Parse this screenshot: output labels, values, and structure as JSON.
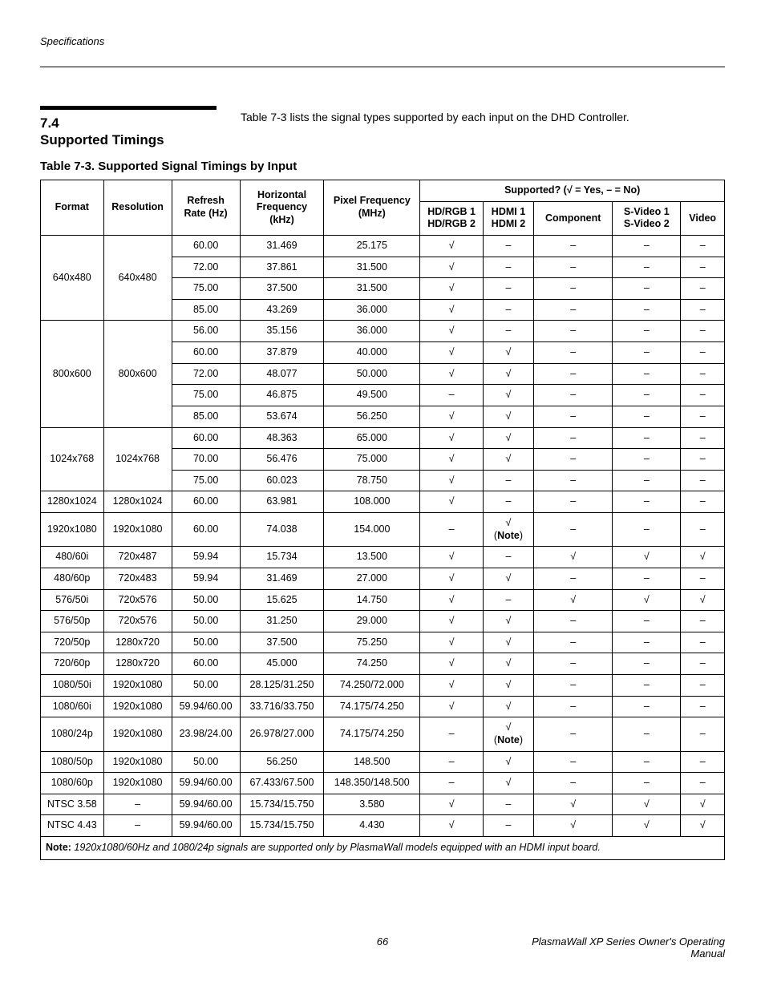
{
  "running_head": "Specifications",
  "section": {
    "number": "7.4",
    "title": "Supported Timings",
    "intro": "Table 7-3 lists the signal types supported by each input on the DHD Controller."
  },
  "table_caption": "Table 7-3. Supported Signal Timings by Input",
  "headers": {
    "format": "Format",
    "resolution": "Resolution",
    "refresh": "Refresh Rate (Hz)",
    "hfreq": "Horizontal Frequency (kHz)",
    "pfreq": "Pixel Frequency (MHz)",
    "supported": "Supported? (√ = Yes, – = No)",
    "hdrgb_l1": "HD/RGB 1",
    "hdrgb_l2": "HD/RGB 2",
    "hdmi_l1": "HDMI 1",
    "hdmi_l2": "HDMI 2",
    "component": "Component",
    "svideo_l1": "S-Video 1",
    "svideo_l2": "S-Video 2",
    "video": "Video"
  },
  "chart_data": {
    "type": "table",
    "title": "Table 7-3. Supported Signal Timings by Input",
    "columns": [
      "Format",
      "Resolution",
      "Refresh Rate (Hz)",
      "Horizontal Frequency (kHz)",
      "Pixel Frequency (MHz)",
      "HD/RGB 1 HD/RGB 2",
      "HDMI 1 HDMI 2",
      "Component",
      "S-Video 1 S-Video 2",
      "Video"
    ],
    "groups": [
      {
        "format": "640x480",
        "resolution": "640x480",
        "rows": [
          {
            "refresh": "60.00",
            "hfreq": "31.469",
            "pfreq": "25.175",
            "hdrgb": "y",
            "hdmi": "n",
            "comp": "n",
            "svid": "n",
            "vid": "n"
          },
          {
            "refresh": "72.00",
            "hfreq": "37.861",
            "pfreq": "31.500",
            "hdrgb": "y",
            "hdmi": "n",
            "comp": "n",
            "svid": "n",
            "vid": "n"
          },
          {
            "refresh": "75.00",
            "hfreq": "37.500",
            "pfreq": "31.500",
            "hdrgb": "y",
            "hdmi": "n",
            "comp": "n",
            "svid": "n",
            "vid": "n"
          },
          {
            "refresh": "85.00",
            "hfreq": "43.269",
            "pfreq": "36.000",
            "hdrgb": "y",
            "hdmi": "n",
            "comp": "n",
            "svid": "n",
            "vid": "n"
          }
        ]
      },
      {
        "format": "800x600",
        "resolution": "800x600",
        "rows": [
          {
            "refresh": "56.00",
            "hfreq": "35.156",
            "pfreq": "36.000",
            "hdrgb": "y",
            "hdmi": "n",
            "comp": "n",
            "svid": "n",
            "vid": "n"
          },
          {
            "refresh": "60.00",
            "hfreq": "37.879",
            "pfreq": "40.000",
            "hdrgb": "y",
            "hdmi": "y",
            "comp": "n",
            "svid": "n",
            "vid": "n"
          },
          {
            "refresh": "72.00",
            "hfreq": "48.077",
            "pfreq": "50.000",
            "hdrgb": "y",
            "hdmi": "y",
            "comp": "n",
            "svid": "n",
            "vid": "n"
          },
          {
            "refresh": "75.00",
            "hfreq": "46.875",
            "pfreq": "49.500",
            "hdrgb": "n",
            "hdmi": "y",
            "comp": "n",
            "svid": "n",
            "vid": "n"
          },
          {
            "refresh": "85.00",
            "hfreq": "53.674",
            "pfreq": "56.250",
            "hdrgb": "y",
            "hdmi": "y",
            "comp": "n",
            "svid": "n",
            "vid": "n"
          }
        ]
      },
      {
        "format": "1024x768",
        "resolution": "1024x768",
        "rows": [
          {
            "refresh": "60.00",
            "hfreq": "48.363",
            "pfreq": "65.000",
            "hdrgb": "y",
            "hdmi": "y",
            "comp": "n",
            "svid": "n",
            "vid": "n"
          },
          {
            "refresh": "70.00",
            "hfreq": "56.476",
            "pfreq": "75.000",
            "hdrgb": "y",
            "hdmi": "y",
            "comp": "n",
            "svid": "n",
            "vid": "n"
          },
          {
            "refresh": "75.00",
            "hfreq": "60.023",
            "pfreq": "78.750",
            "hdrgb": "y",
            "hdmi": "n",
            "comp": "n",
            "svid": "n",
            "vid": "n"
          }
        ]
      },
      {
        "format": "1280x1024",
        "resolution": "1280x1024",
        "rows": [
          {
            "refresh": "60.00",
            "hfreq": "63.981",
            "pfreq": "108.000",
            "hdrgb": "y",
            "hdmi": "n",
            "comp": "n",
            "svid": "n",
            "vid": "n"
          }
        ]
      },
      {
        "format": "1920x1080",
        "resolution": "1920x1080",
        "rows": [
          {
            "refresh": "60.00",
            "hfreq": "74.038",
            "pfreq": "154.000",
            "hdrgb": "n",
            "hdmi": "note",
            "comp": "n",
            "svid": "n",
            "vid": "n"
          }
        ]
      },
      {
        "format": "480/60i",
        "resolution": "720x487",
        "rows": [
          {
            "refresh": "59.94",
            "hfreq": "15.734",
            "pfreq": "13.500",
            "hdrgb": "y",
            "hdmi": "n",
            "comp": "y",
            "svid": "y",
            "vid": "y"
          }
        ]
      },
      {
        "format": "480/60p",
        "resolution": "720x483",
        "rows": [
          {
            "refresh": "59.94",
            "hfreq": "31.469",
            "pfreq": "27.000",
            "hdrgb": "y",
            "hdmi": "y",
            "comp": "n",
            "svid": "n",
            "vid": "n"
          }
        ]
      },
      {
        "format": "576/50i",
        "resolution": "720x576",
        "rows": [
          {
            "refresh": "50.00",
            "hfreq": "15.625",
            "pfreq": "14.750",
            "hdrgb": "y",
            "hdmi": "n",
            "comp": "y",
            "svid": "y",
            "vid": "y"
          }
        ]
      },
      {
        "format": "576/50p",
        "resolution": "720x576",
        "rows": [
          {
            "refresh": "50.00",
            "hfreq": "31.250",
            "pfreq": "29.000",
            "hdrgb": "y",
            "hdmi": "y",
            "comp": "n",
            "svid": "n",
            "vid": "n"
          }
        ]
      },
      {
        "format": "720/50p",
        "resolution": "1280x720",
        "rows": [
          {
            "refresh": "50.00",
            "hfreq": "37.500",
            "pfreq": "75.250",
            "hdrgb": "y",
            "hdmi": "y",
            "comp": "n",
            "svid": "n",
            "vid": "n"
          }
        ]
      },
      {
        "format": "720/60p",
        "resolution": "1280x720",
        "rows": [
          {
            "refresh": "60.00",
            "hfreq": "45.000",
            "pfreq": "74.250",
            "hdrgb": "y",
            "hdmi": "y",
            "comp": "n",
            "svid": "n",
            "vid": "n"
          }
        ]
      },
      {
        "format": "1080/50i",
        "resolution": "1920x1080",
        "rows": [
          {
            "refresh": "50.00",
            "hfreq": "28.125/31.250",
            "pfreq": "74.250/72.000",
            "hdrgb": "y",
            "hdmi": "y",
            "comp": "n",
            "svid": "n",
            "vid": "n"
          }
        ]
      },
      {
        "format": "1080/60i",
        "resolution": "1920x1080",
        "rows": [
          {
            "refresh": "59.94/60.00",
            "hfreq": "33.716/33.750",
            "pfreq": "74.175/74.250",
            "hdrgb": "y",
            "hdmi": "y",
            "comp": "n",
            "svid": "n",
            "vid": "n"
          }
        ]
      },
      {
        "format": "1080/24p",
        "resolution": "1920x1080",
        "rows": [
          {
            "refresh": "23.98/24.00",
            "hfreq": "26.978/27.000",
            "pfreq": "74.175/74.250",
            "hdrgb": "n",
            "hdmi": "note",
            "comp": "n",
            "svid": "n",
            "vid": "n"
          }
        ]
      },
      {
        "format": "1080/50p",
        "resolution": "1920x1080",
        "rows": [
          {
            "refresh": "50.00",
            "hfreq": "56.250",
            "pfreq": "148.500",
            "hdrgb": "n",
            "hdmi": "y",
            "comp": "n",
            "svid": "n",
            "vid": "n"
          }
        ]
      },
      {
        "format": "1080/60p",
        "resolution": "1920x1080",
        "rows": [
          {
            "refresh": "59.94/60.00",
            "hfreq": "67.433/67.500",
            "pfreq": "148.350/148.500",
            "hdrgb": "n",
            "hdmi": "y",
            "comp": "n",
            "svid": "n",
            "vid": "n"
          }
        ]
      },
      {
        "format": "NTSC 3.58",
        "resolution": "–",
        "rows": [
          {
            "refresh": "59.94/60.00",
            "hfreq": "15.734/15.750",
            "pfreq": "3.580",
            "hdrgb": "y",
            "hdmi": "n",
            "comp": "y",
            "svid": "y",
            "vid": "y"
          }
        ]
      },
      {
        "format": "NTSC 4.43",
        "resolution": "–",
        "rows": [
          {
            "refresh": "59.94/60.00",
            "hfreq": "15.734/15.750",
            "pfreq": "4.430",
            "hdrgb": "y",
            "hdmi": "n",
            "comp": "y",
            "svid": "y",
            "vid": "y"
          }
        ]
      }
    ],
    "note_label": "Note:",
    "note_text": " 1920x1080/60Hz and 1080/24p signals are supported only by PlasmaWall models equipped with an HDMI input board.",
    "hdmi_note_label": "Note"
  },
  "footer": {
    "page": "66",
    "right": "PlasmaWall XP Series Owner's Operating Manual"
  }
}
